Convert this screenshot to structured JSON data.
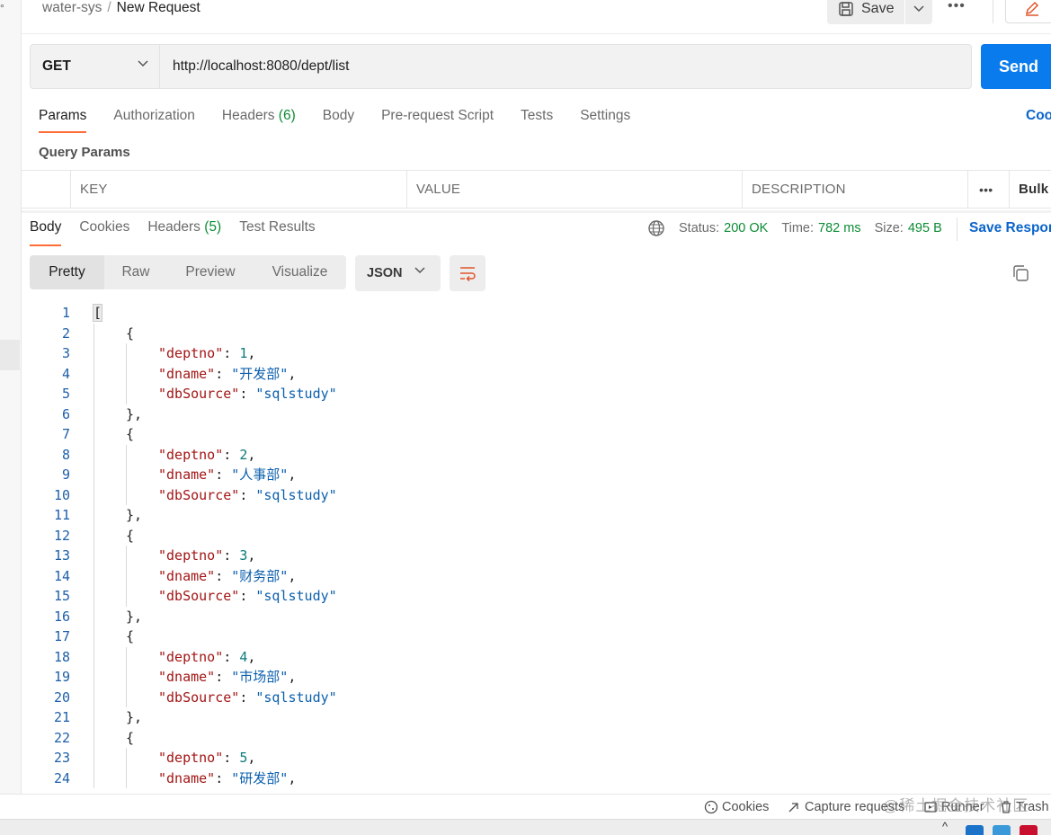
{
  "header": {
    "collection": "water-sys",
    "separator": "/",
    "request_name": "New Request",
    "save_label": "Save",
    "more_icon": "ellipsis-icon",
    "edit_icon": "pencil-icon"
  },
  "request": {
    "method": "GET",
    "url": "http://localhost:8080/dept/list",
    "send_label": "Send"
  },
  "request_tabs": {
    "params": "Params",
    "authorization": "Authorization",
    "headers": "Headers",
    "headers_count": "(6)",
    "body": "Body",
    "pre_request": "Pre-request Script",
    "tests": "Tests",
    "settings": "Settings",
    "cookies_link": "Coo"
  },
  "query_params": {
    "title": "Query Params",
    "col_key": "KEY",
    "col_value": "VALUE",
    "col_description": "DESCRIPTION",
    "bulk_edit": "Bulk"
  },
  "response_tabs": {
    "body": "Body",
    "cookies": "Cookies",
    "headers": "Headers",
    "headers_count": "(5)",
    "test_results": "Test Results"
  },
  "response_meta": {
    "status_label": "Status:",
    "status_value": "200 OK",
    "time_label": "Time:",
    "time_value": "782 ms",
    "size_label": "Size:",
    "size_value": "495 B",
    "save_response": "Save Respon"
  },
  "view": {
    "modes": [
      "Pretty",
      "Raw",
      "Preview",
      "Visualize"
    ],
    "active": "Pretty",
    "format": "JSON"
  },
  "code": {
    "open_bracket": "[",
    "open_brace": "{",
    "close_brace_comma": "},",
    "key_deptno": "\"deptno\"",
    "key_dname": "\"dname\"",
    "key_dbsource": "\"dbSource\"",
    "colon": ": ",
    "comma": ",",
    "records": [
      {
        "deptno": "1",
        "dname": "\"开发部\"",
        "dbSource": "\"sqlstudy\""
      },
      {
        "deptno": "2",
        "dname": "\"人事部\"",
        "dbSource": "\"sqlstudy\""
      },
      {
        "deptno": "3",
        "dname": "\"财务部\"",
        "dbSource": "\"sqlstudy\""
      },
      {
        "deptno": "4",
        "dname": "\"市场部\"",
        "dbSource": "\"sqlstudy\""
      },
      {
        "deptno": "5",
        "dname": "\"研发部\"",
        "dbSource": ""
      }
    ]
  },
  "footer": {
    "cookies": "Cookies",
    "capture": "Capture requests",
    "runner": "Runner",
    "trash": "Trash",
    "watermark": "@稀土掘金技术社区"
  }
}
